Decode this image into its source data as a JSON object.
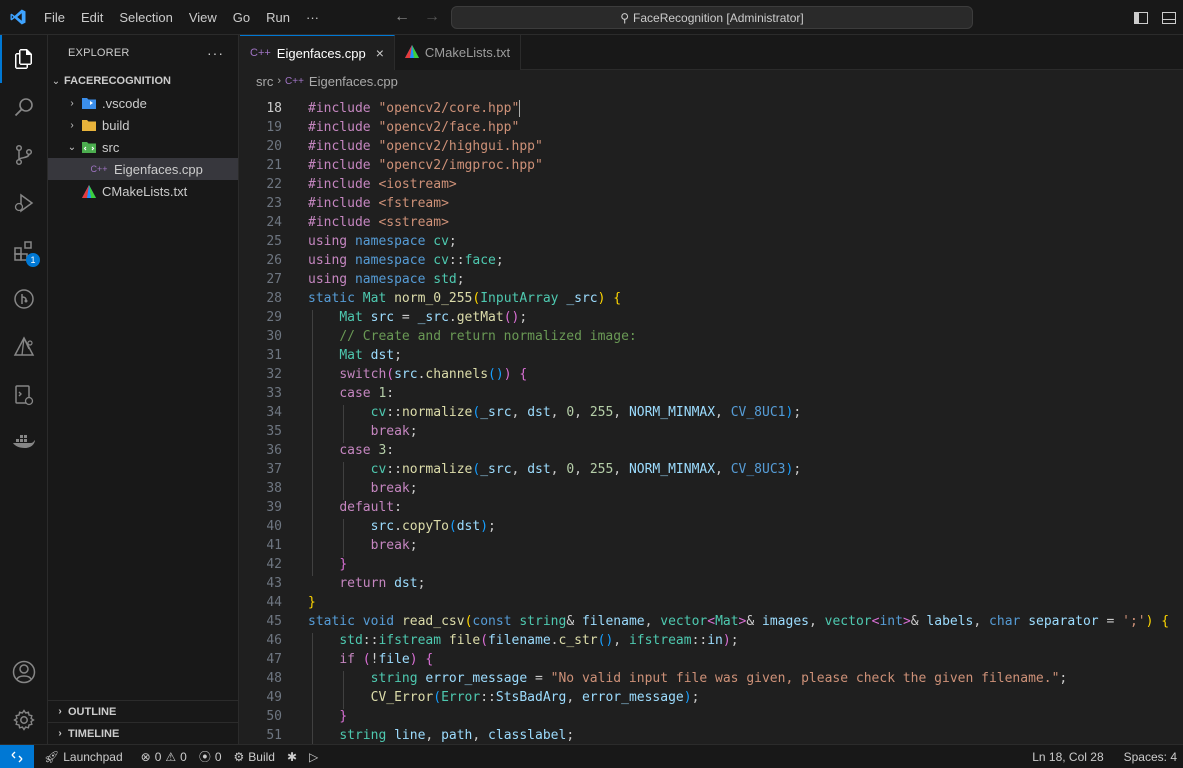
{
  "titlebar": {
    "menu": [
      "File",
      "Edit",
      "Selection",
      "View",
      "Go",
      "Run",
      "···"
    ],
    "command_center": "FaceRecognition [Administrator]"
  },
  "activity_badge": "1",
  "explorer": {
    "header": "EXPLORER",
    "more": "···",
    "root": "FACERECOGNITION",
    "items": [
      {
        "label": ".vscode"
      },
      {
        "label": "build"
      },
      {
        "label": "src"
      },
      {
        "label": "Eigenfaces.cpp"
      },
      {
        "label": "CMakeLists.txt"
      }
    ],
    "outline": "OUTLINE",
    "timeline": "TIMELINE"
  },
  "tabs": [
    {
      "label": "Eigenfaces.cpp",
      "icon": "C++",
      "close": "×"
    },
    {
      "label": "CMakeLists.txt"
    }
  ],
  "breadcrumb": {
    "folder": "src",
    "icon": "C++",
    "file": "Eigenfaces.cpp"
  },
  "editor": {
    "line_numbers": [
      "18",
      "19",
      "20",
      "21",
      "22",
      "23",
      "24",
      "25",
      "26",
      "27",
      "28",
      "29",
      "30",
      "31",
      "32",
      "33",
      "34",
      "35",
      "36",
      "37",
      "38",
      "39",
      "40",
      "41",
      "42",
      "43",
      "44",
      "45",
      "46",
      "47",
      "48",
      "49",
      "50",
      "51"
    ],
    "current_line": "18"
  },
  "statusbar": {
    "launchpad": "Launchpad",
    "errors": "0",
    "warnings": "0",
    "ports": "0",
    "build": "Build",
    "position": "Ln 18, Col 28",
    "spaces": "Spaces: 4"
  },
  "colors": {
    "accent": "#0078d4",
    "keyword": "#569cd6",
    "control": "#c586c0",
    "string": "#ce9178",
    "type": "#4ec9b0",
    "function": "#dcdcaa",
    "comment": "#6a9955"
  }
}
